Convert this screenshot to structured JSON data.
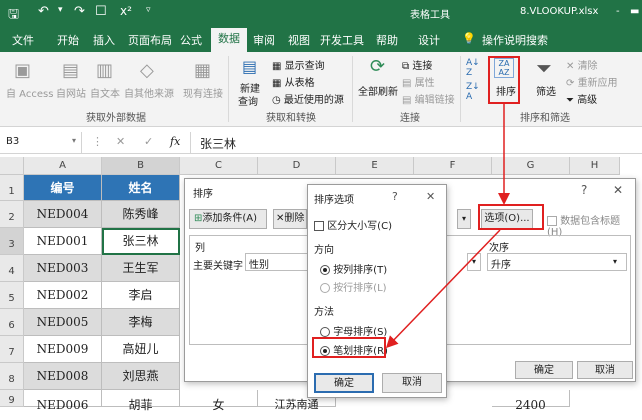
{
  "titlebar": {
    "table_tools": "表格工具",
    "filename": "8.VLOOKUP.xlsx",
    "dash": "-"
  },
  "menu": [
    "文件",
    "开始",
    "插入",
    "页面布局",
    "公式",
    "数据",
    "审阅",
    "视图",
    "开发工具",
    "帮助",
    "设计"
  ],
  "tell_me": "操作说明搜索",
  "ribbon": {
    "get_external": {
      "items": [
        "自 Access",
        "自网站",
        "自文本",
        "自其他来源",
        "现有连接"
      ],
      "label": "获取外部数据"
    },
    "transform": {
      "new_query": "新建",
      "new_query2": "查询",
      "items": [
        "显示查询",
        "从表格",
        "最近使用的源"
      ],
      "label": "获取和转换"
    },
    "connections": {
      "refresh": "全部刷新",
      "items": [
        "连接",
        "属性",
        "编辑链接"
      ],
      "label": "连接"
    },
    "sort_filter": {
      "sort": "排序",
      "filter": "筛选",
      "items": [
        "清除",
        "重新应用",
        "高级"
      ],
      "label": "排序和筛选"
    }
  },
  "formula_bar": {
    "name_box": "B3",
    "fx": "fx",
    "value": "张三林"
  },
  "columns": [
    "A",
    "B",
    "C",
    "D",
    "E",
    "F",
    "G",
    "H"
  ],
  "headers": [
    "编号",
    "姓名"
  ],
  "rows": [
    [
      "NED004",
      "陈秀峰"
    ],
    [
      "NED001",
      "张三林"
    ],
    [
      "NED003",
      "王生军"
    ],
    [
      "NED002",
      "李启"
    ],
    [
      "NED005",
      "李梅"
    ],
    [
      "NED009",
      "高妞儿"
    ],
    [
      "NED008",
      "刘思燕"
    ],
    [
      "NED006",
      "胡菲",
      "女",
      "江苏南通",
      "",
      "2400"
    ]
  ],
  "row_numbers": [
    "1",
    "2",
    "3",
    "4",
    "5",
    "6",
    "7",
    "8",
    "9"
  ],
  "sort_dialog": {
    "title": "排序",
    "add": "添加条件(A)",
    "delete": "删除",
    "options": "选项(O)...",
    "has_header": "数据包含标题(H)",
    "col_header": "列",
    "order_header": "次序",
    "key_label": "主要关键字",
    "key_value": "性别",
    "order_value": "升序",
    "ok": "确定",
    "cancel": "取消",
    "question": "?",
    "close": "✕"
  },
  "options_dialog": {
    "title": "排序选项",
    "question": "?",
    "close": "✕",
    "case": "区分大小写(C)",
    "direction": "方向",
    "dir_items": [
      "按列排序(T)",
      "按行排序(L)"
    ],
    "method": "方法",
    "method_items": [
      "字母排序(S)",
      "笔划排序(R)"
    ],
    "ok": "确定",
    "cancel": "取消"
  }
}
